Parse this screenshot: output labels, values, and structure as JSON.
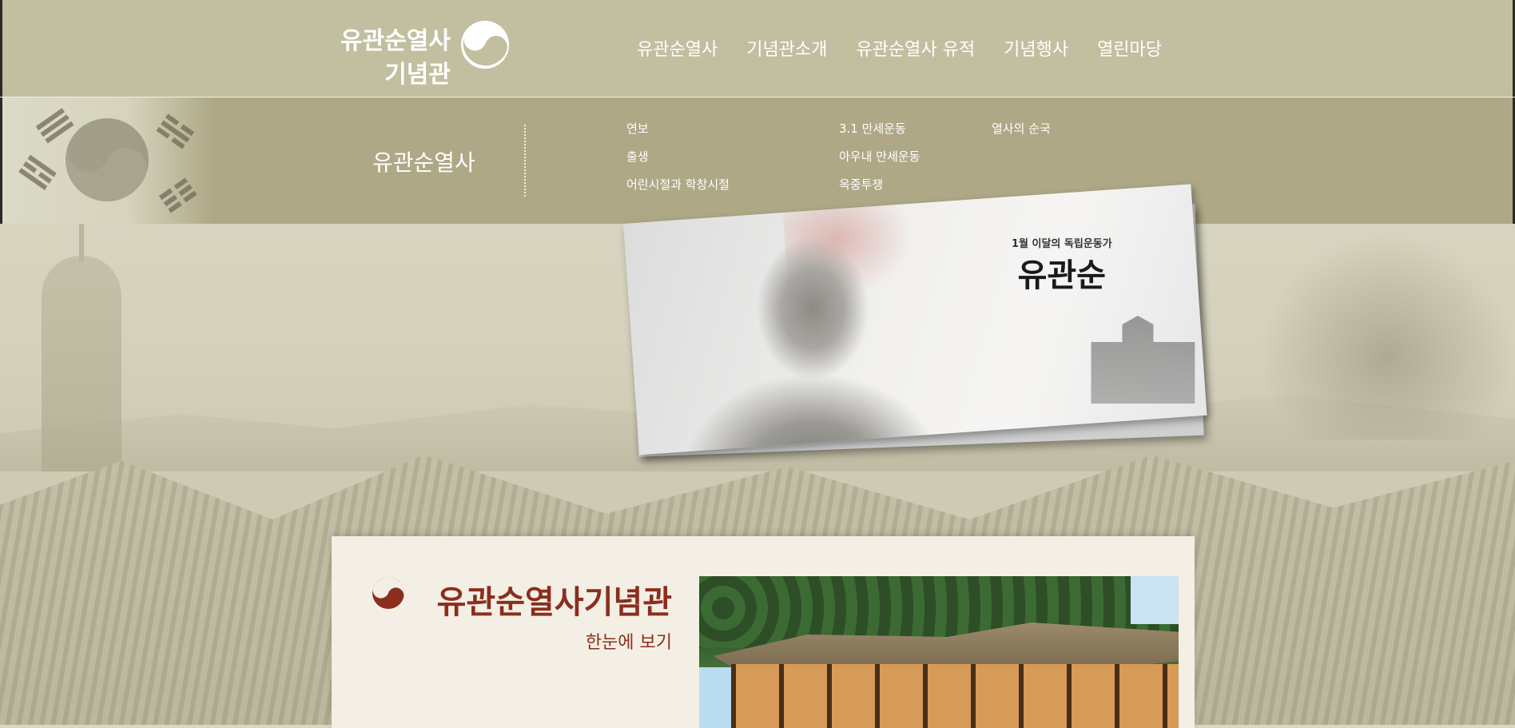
{
  "site": {
    "logo_line1": "유관순열사",
    "logo_line2": "기념관"
  },
  "gnb": {
    "items": [
      "유관순열사",
      "기념관소개",
      "유관순열사 유적",
      "기념행사",
      "열린마당"
    ]
  },
  "submenu": {
    "title": "유관순열사",
    "col1": [
      "연보",
      "출생",
      "어린시절과 학창시절"
    ],
    "col2": [
      "3.1 만세운동",
      "아우내 만세운동",
      "옥중투쟁"
    ],
    "col3": [
      "열사의 순국"
    ]
  },
  "hero": {
    "caption": "1월 이달의 독립운동가",
    "name": "유관순"
  },
  "intro": {
    "title": "유관순열사기념관",
    "subtitle": "한눈에 보기"
  },
  "colors": {
    "header_bg": "#c2bfa1",
    "submenu_bg": "#aea886",
    "accent_red": "#8b2e1e",
    "panel_bg": "#f4efe4"
  }
}
